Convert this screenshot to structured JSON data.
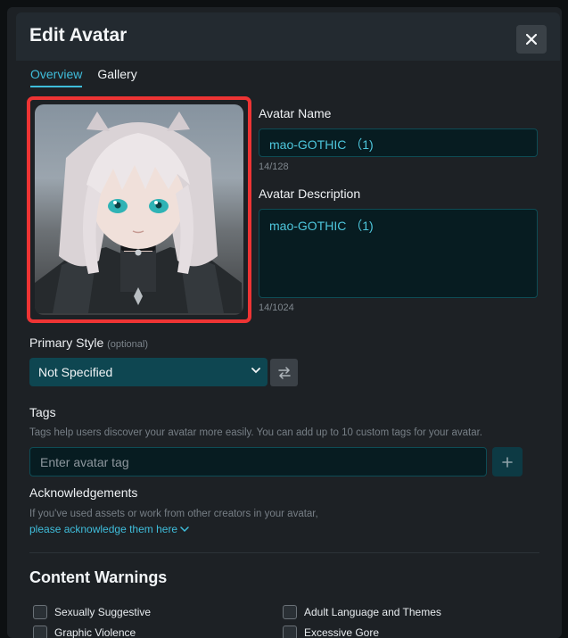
{
  "modal": {
    "title": "Edit Avatar",
    "close_icon": "close-icon"
  },
  "tabs": [
    {
      "label": "Overview",
      "active": true
    },
    {
      "label": "Gallery",
      "active": false
    }
  ],
  "avatar_name": {
    "label": "Avatar Name",
    "value": "mao-GOTHIC （1)",
    "counter": "14/128"
  },
  "avatar_description": {
    "label": "Avatar Description",
    "value": "mao-GOTHIC （1)",
    "counter": "14/1024"
  },
  "primary_style": {
    "label": "Primary Style",
    "optional": "(optional)",
    "selected": "Not Specified",
    "swap_icon": "swap-icon"
  },
  "tags": {
    "label": "Tags",
    "help": "Tags help users discover your avatar more easily. You can add up to 10 custom tags for your avatar.",
    "placeholder": "Enter avatar tag",
    "add_icon": "plus-icon"
  },
  "acknowledgements": {
    "label": "Acknowledgements",
    "help": "If you've used assets or work from other creators in your avatar,",
    "link": "please acknowledge them here"
  },
  "content_warnings": {
    "title": "Content Warnings",
    "items": [
      {
        "label": "Sexually Suggestive",
        "checked": false
      },
      {
        "label": "Adult Language and Themes",
        "checked": false
      },
      {
        "label": "Graphic Violence",
        "checked": false
      },
      {
        "label": "Excessive Gore",
        "checked": false
      }
    ]
  },
  "colors": {
    "accent": "#3fbddb",
    "highlight_border": "#ee3434",
    "select_bg": "#0e4651"
  }
}
